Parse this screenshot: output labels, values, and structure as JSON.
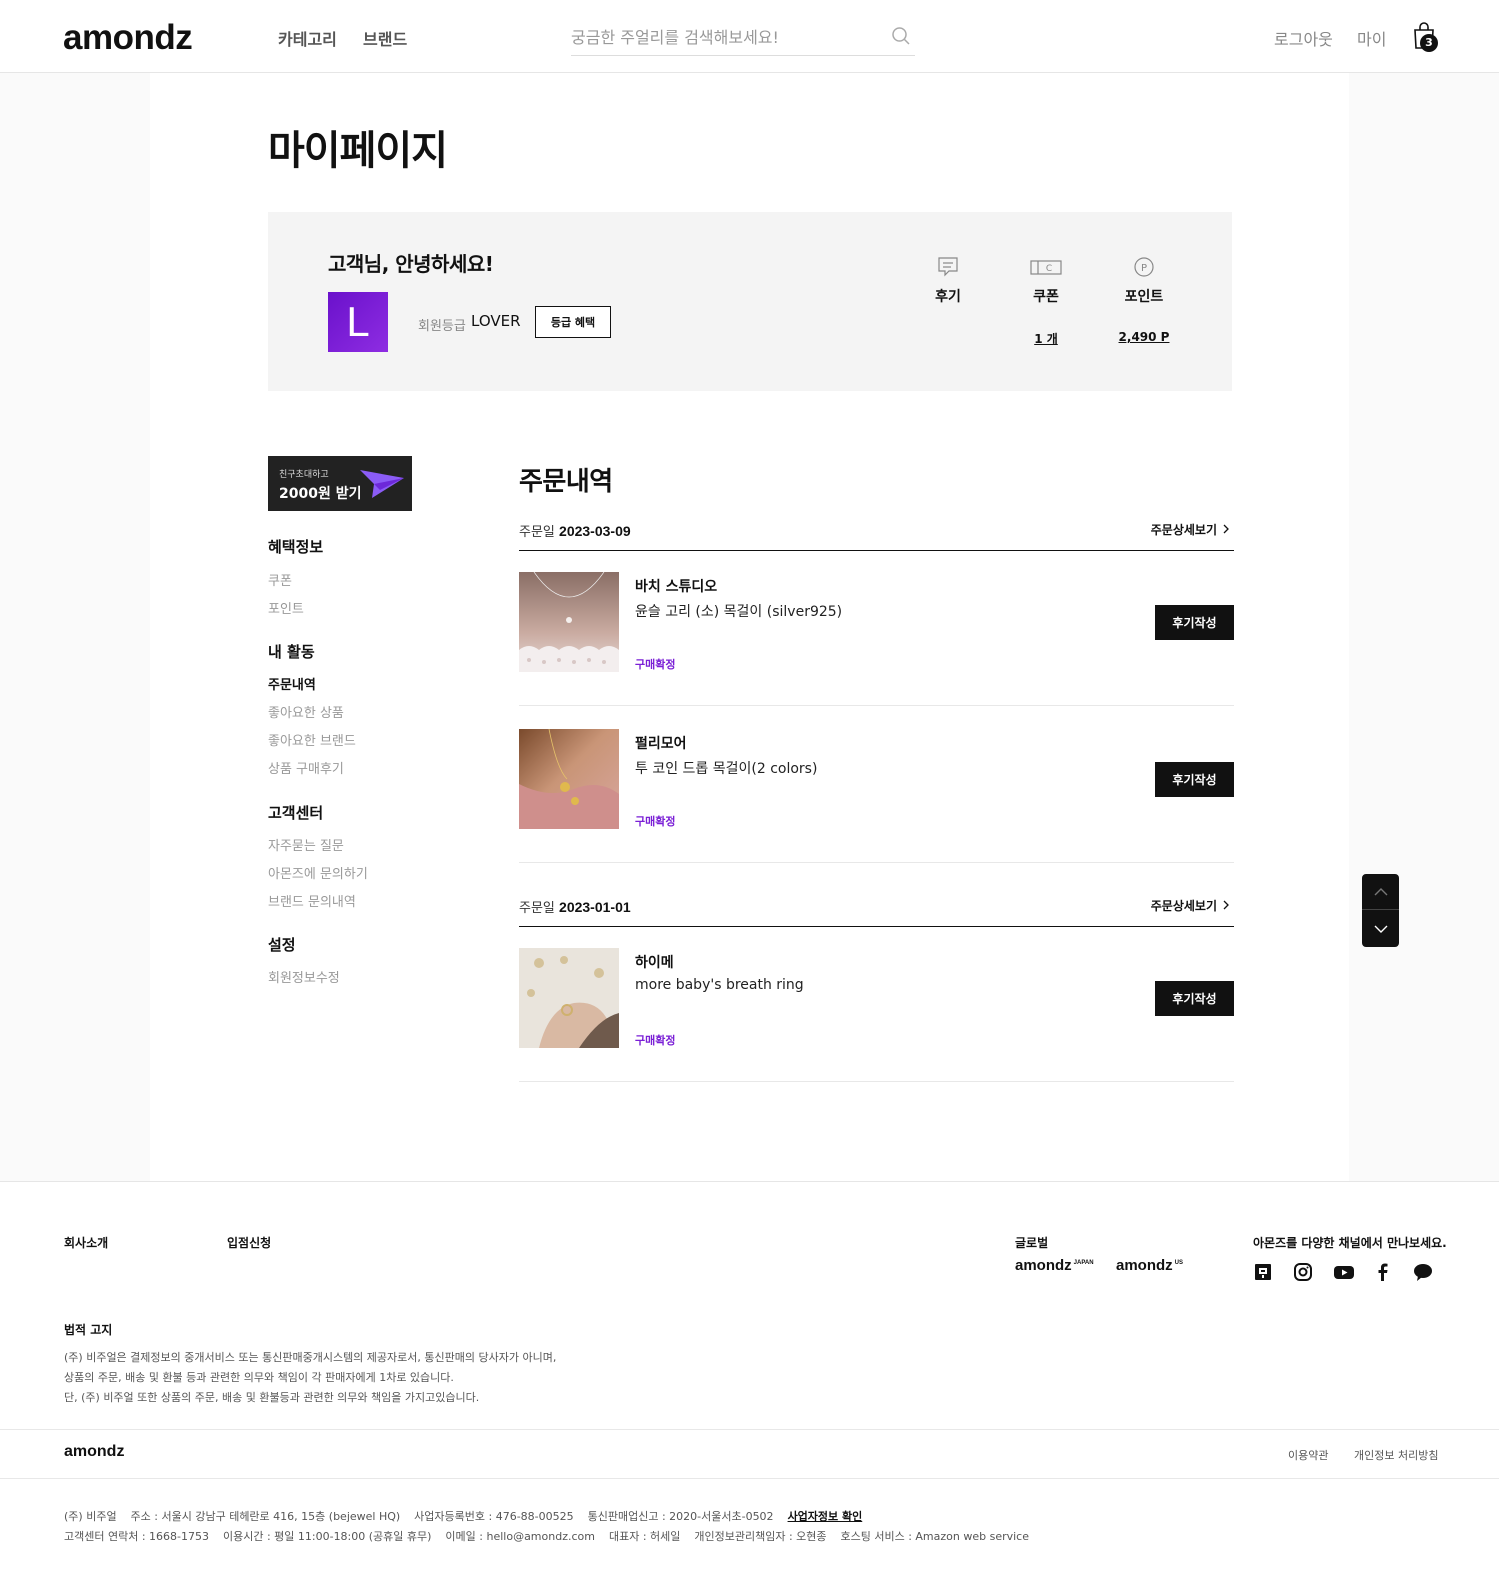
{
  "header": {
    "logo": "amondz",
    "nav": [
      "카테고리",
      "브랜드"
    ],
    "search_placeholder": "궁금한 주얼리를 검색해보세요!",
    "logout": "로그아웃",
    "my": "마이",
    "cart_count": "3"
  },
  "page_title": "마이페이지",
  "summary": {
    "greeting": "고객님, 안녕하세요!",
    "grade_initial": "L",
    "grade_label": "회원등급",
    "grade_value": "LOVER",
    "grade_button": "등급 혜택",
    "stats": [
      {
        "label": "후기",
        "value": "",
        "icon": "review-icon"
      },
      {
        "label": "쿠폰",
        "value": "1 개",
        "icon": "coupon-icon"
      },
      {
        "label": "포인트",
        "value": "2,490 P",
        "icon": "point-icon"
      }
    ]
  },
  "sidebar": {
    "invite_sub": "친구초대하고",
    "invite_main": "2000원 받기",
    "sections": [
      {
        "title": "혜택정보",
        "items": [
          "쿠폰",
          "포인트"
        ]
      },
      {
        "title": "내 활동",
        "items": [
          "주문내역",
          "좋아요한 상품",
          "좋아요한 브랜드",
          "상품 구매후기"
        ]
      },
      {
        "title": "고객센터",
        "items": [
          "자주묻는 질문",
          "아몬즈에 문의하기",
          "브랜드 문의내역"
        ]
      },
      {
        "title": "설정",
        "items": [
          "회원정보수정"
        ]
      }
    ],
    "active_item": "주문내역"
  },
  "orders": {
    "title": "주문내역",
    "date_label": "주문일",
    "detail_label": "주문상세보기",
    "review_button": "후기작성",
    "groups": [
      {
        "date": "2023-03-09",
        "items": [
          {
            "brand": "바치 스튜디오",
            "name": "윤슬 고리 (소) 목걸이 (silver925)",
            "status": "구매확정"
          },
          {
            "brand": "펄리모어",
            "name": "투 코인 드롭 목걸이(2 colors)",
            "status": "구매확정"
          }
        ]
      },
      {
        "date": "2023-01-01",
        "items": [
          {
            "brand": "하이메",
            "name": "more baby's breath ring",
            "status": "구매확정"
          }
        ]
      }
    ]
  },
  "footer": {
    "links": [
      "회사소개",
      "입점신청"
    ],
    "global_label": "글로벌",
    "global_sites": [
      {
        "name": "amondz",
        "region": "JAPAN"
      },
      {
        "name": "amondz",
        "region": "US"
      }
    ],
    "channel_label": "아몬즈를 다양한 채널에서 만나보세요.",
    "sns": [
      "blog-icon",
      "instagram-icon",
      "youtube-icon",
      "facebook-icon",
      "kakao-icon"
    ],
    "legal_title": "법적 고지",
    "legal_lines": [
      "(주) 비주얼은 결제정보의 중개서비스 또는 통신판매중개시스템의 제공자로서, 통신판매의 당사자가 아니며,",
      "상품의 주문, 배송 및 환불 등과 관련한 의무와 책임이 각 판매자에게 1차로 있습니다.",
      "단, (주) 비주얼 또한 상품의 주문, 배송 및 환불등과 관련한 의무와 책임을 가지고있습니다."
    ],
    "bottom_logo": "amondz",
    "terms": "이용약관",
    "privacy": "개인정보 처리방침",
    "info_line1": "(주) 비주얼    주소 : 서울시 강남구 테헤란로 416, 15층 (bejewel HQ)    사업자등록번호 : 476-88-00525    통신판매업신고 : 2020-서울서초-0502",
    "biz_check": "사업자정보 확인",
    "info_line2": "고객센터 연락처 : 1668-1753    이용시간 : 평일 11:00-18:00 (공휴일 휴무)    이메일 : hello@amondz.com    대표자 : 허세일    개인정보관리책임자 : 오현종    호스팅 서비스 : Amazon web service"
  }
}
